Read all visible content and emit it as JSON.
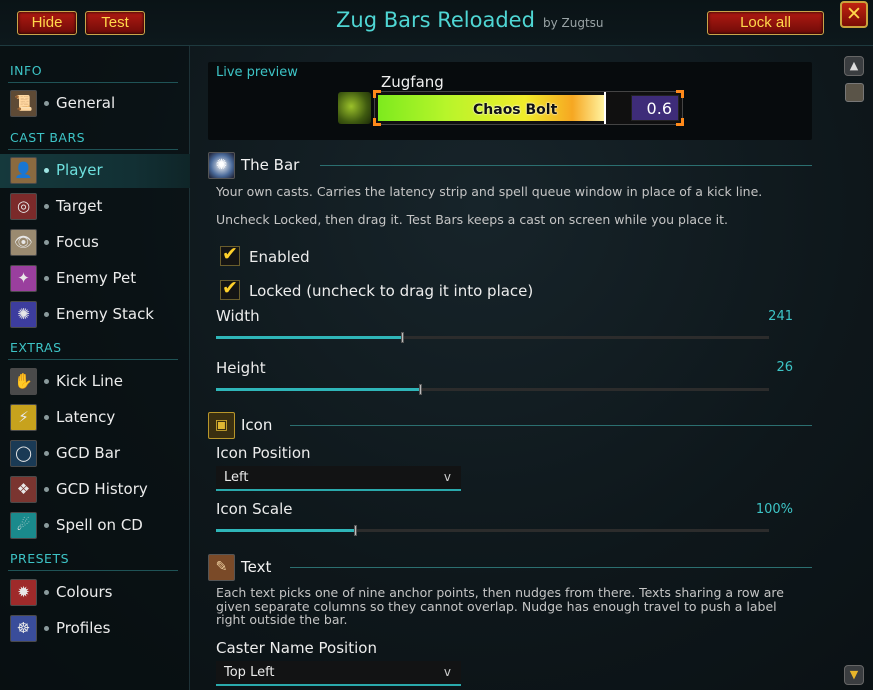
{
  "header": {
    "hide_label": "Hide",
    "test_label": "Test",
    "title": "Zug Bars Reloaded",
    "byline": "by Zugtsu",
    "lock_label": "Lock all",
    "close_glyph": "✕"
  },
  "sidebar": {
    "sections": [
      {
        "title": "INFO"
      },
      {
        "title": "CAST BARS"
      },
      {
        "title": "EXTRAS"
      },
      {
        "title": "PRESETS"
      }
    ],
    "items": [
      {
        "label": "General",
        "icon": "general-icon",
        "glyph": "📜"
      },
      {
        "label": "Player",
        "icon": "player-icon",
        "glyph": "👤"
      },
      {
        "label": "Target",
        "icon": "target-icon",
        "glyph": "◎"
      },
      {
        "label": "Focus",
        "icon": "focus-icon",
        "glyph": "👁"
      },
      {
        "label": "Enemy Pet",
        "icon": "enemy-pet-icon",
        "glyph": "✦"
      },
      {
        "label": "Enemy Stack",
        "icon": "enemy-stack-icon",
        "glyph": "✺"
      },
      {
        "label": "Kick Line",
        "icon": "kick-line-icon",
        "glyph": "✋"
      },
      {
        "label": "Latency",
        "icon": "latency-icon",
        "glyph": "⚡"
      },
      {
        "label": "GCD Bar",
        "icon": "gcd-bar-icon",
        "glyph": "◯"
      },
      {
        "label": "GCD History",
        "icon": "gcd-history-icon",
        "glyph": "❖"
      },
      {
        "label": "Spell on CD",
        "icon": "spell-on-cd-icon",
        "glyph": "☄"
      },
      {
        "label": "Colours",
        "icon": "colours-icon",
        "glyph": "✹"
      },
      {
        "label": "Profiles",
        "icon": "profiles-icon",
        "glyph": "☸"
      }
    ],
    "active_item": "Player"
  },
  "preview": {
    "label": "Live preview",
    "caster_name": "Zugfang",
    "spell_name": "Chaos Bolt",
    "time_left": "0.6",
    "spell_icon": "chaos-bolt-icon",
    "progress": 0.75,
    "colors": {
      "bar_start": "#7dea1e",
      "bar_end": "#f6a722",
      "time_box": "#3e2c79",
      "corners": "#ff8a1a"
    }
  },
  "bar_section": {
    "title": "The Bar",
    "icon": "the-bar-icon",
    "desc1": "Your own casts. Carries the latency strip and spell queue window in place of a kick line.",
    "desc2": "Uncheck Locked, then drag it. Test Bars keeps a cast on screen while you place it.",
    "enabled_label": "Enabled",
    "enabled_checked": true,
    "locked_label": "Locked (uncheck to drag it into place)",
    "locked_checked": true,
    "width_label": "Width",
    "width_value": "241",
    "width_fraction": 0.338,
    "height_label": "Height",
    "height_value": "26",
    "height_fraction": 0.371
  },
  "icon_section": {
    "title": "Icon",
    "icon": "icon-section-icon",
    "position_label": "Icon Position",
    "position_value": "Left",
    "position_arrow": "v",
    "scale_label": "Icon Scale",
    "scale_value": "100%",
    "scale_fraction": 0.254
  },
  "text_section": {
    "title": "Text",
    "icon": "text-section-icon",
    "desc": "Each text picks one of nine anchor points, then nudges from there. Texts sharing a row are given separate columns so they cannot overlap. Nudge has enough travel to push a label right outside the bar.",
    "caster_pos_label": "Caster Name Position",
    "caster_pos_value": "Top Left",
    "caster_pos_arrow": "v"
  },
  "scrollbar": {
    "up_glyph": "▲",
    "down_glyph": "▼"
  },
  "colors": {
    "accent": "#3dc4c6",
    "button_red": "#b01a12",
    "button_text": "#ffd84a",
    "check": "#ffd02a"
  }
}
